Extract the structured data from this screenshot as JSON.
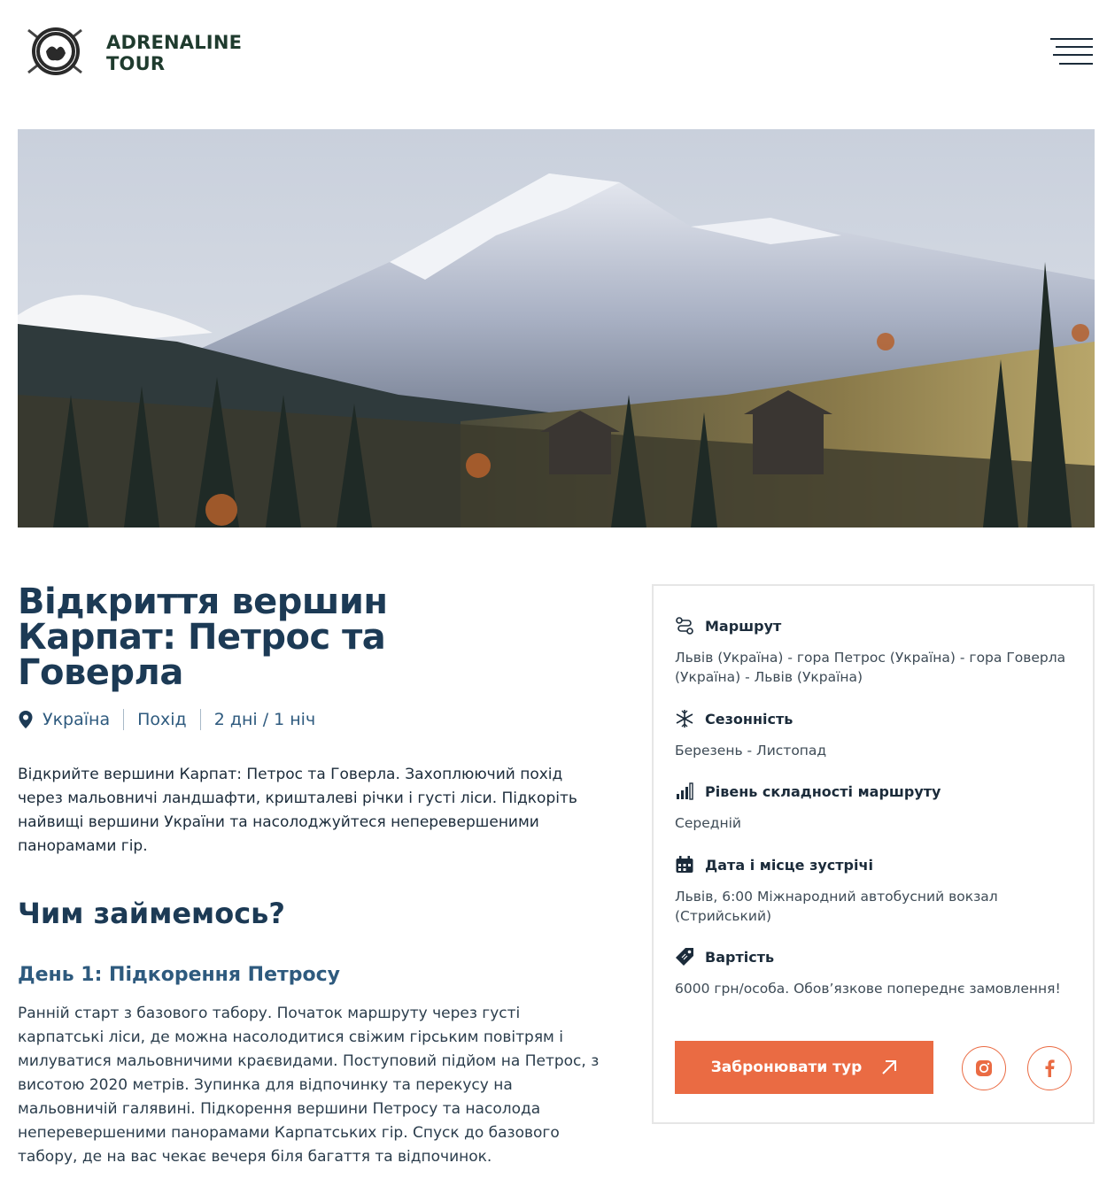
{
  "header": {
    "brand_line1": "ADRENALINE",
    "brand_line2": "TOUR",
    "logo_icon": "logo-emblem",
    "menu_icon": "hamburger-menu-icon"
  },
  "hero": {
    "image": "mountain-landscape-photo"
  },
  "tour": {
    "title": "Відкриття вершин Карпат: Петрос та Говерла",
    "location": "Україна",
    "type": "Похід",
    "duration": "2 дні / 1 ніч",
    "intro": "Відкрийте вершини Карпат: Петрос та Говерла. Захоплюючий похід через мальовничі ландшафти, кришталеві річки і густі ліси. Підкоріть найвищі вершини України та насолоджуйтеся неперевершеними панорамами гір.",
    "section_title": "Чим займемось?",
    "day1_title": "День 1: Підкорення Петросу",
    "day1_text": "Ранній старт з базового табору. Початок маршруту через густі карпатські ліси, де можна насолодитися свіжим гірським повітрям і милуватися мальовничими краєвидами. Поступовий підйом на Петрос, з висотою 2020 метрів. Зупинка для відпочинку та перекусу на мальовничій галявині. Підкорення вершини Петросу та насолода неперевершеними панорамами Карпатських гір. Спуск до базового табору, де на вас чекає вечеря біля багаття та відпочинок."
  },
  "info": {
    "route_label": "Маршрут",
    "route_value": "Львів (Україна) - гора Петрос (Україна) - гора Говерла (Україна) - Львів (Україна)",
    "season_label": "Сезонність",
    "season_value": "Березень - Листопад",
    "difficulty_label": "Рівень складності маршруту",
    "difficulty_value": "Середній",
    "meeting_label": "Дата і місце зустрічі",
    "meeting_value": "Львів, 6:00 Міжнародний автобусний вокзал (Стрийський)",
    "price_label": "Вартість",
    "price_value": "6000 грн/особа. Обов’язкове попереднє замовлення!",
    "book_label": "Забронювати тур"
  },
  "colors": {
    "accent": "#ea6b43",
    "heading": "#1c3a55",
    "subheading": "#2e5a7e",
    "brand": "#1f3b2e"
  }
}
